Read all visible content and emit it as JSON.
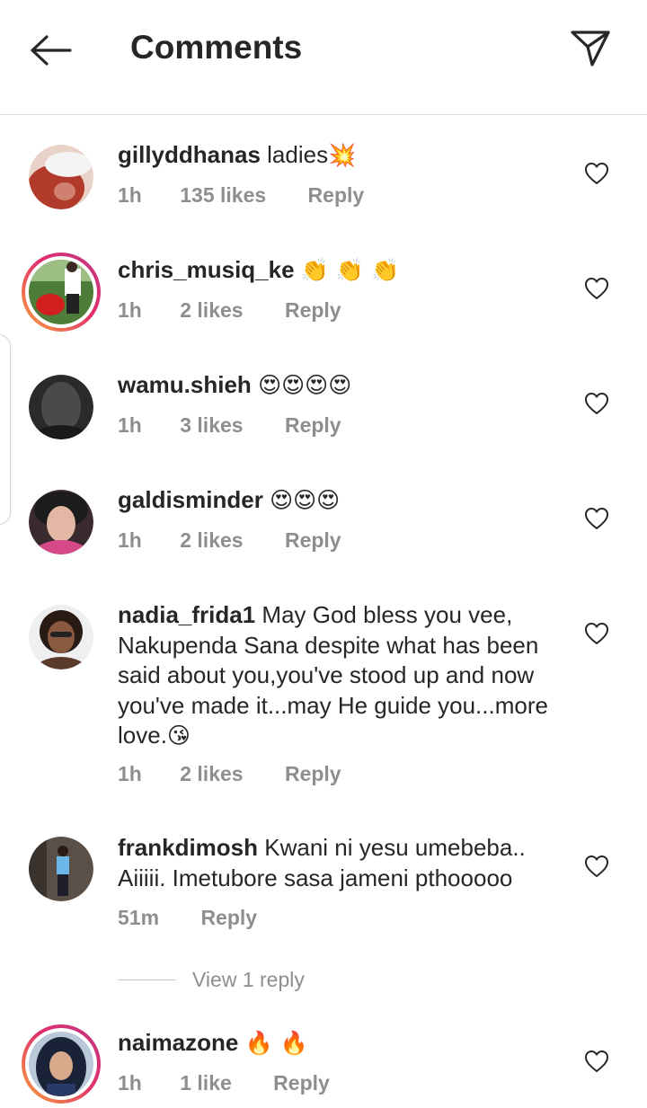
{
  "header": {
    "title": "Comments",
    "back_icon": "back-arrow-icon",
    "share_icon": "direct-send-icon"
  },
  "comments": [
    {
      "username": "gillyddhanas",
      "text": "ladies",
      "emoji": "💥",
      "time": "1h",
      "likes": "135 likes",
      "reply": "Reply",
      "story_ring": false
    },
    {
      "username": "chris_musiq_ke",
      "text": "",
      "emoji": "👏 👏 👏",
      "time": "1h",
      "likes": "2 likes",
      "reply": "Reply",
      "story_ring": true
    },
    {
      "username": "wamu.shieh",
      "text": "",
      "emoji": "😍😍😍😍",
      "time": "1h",
      "likes": "3 likes",
      "reply": "Reply",
      "story_ring": false
    },
    {
      "username": "galdisminder",
      "text": "",
      "emoji": "😍😍😍",
      "time": "1h",
      "likes": "2 likes",
      "reply": "Reply",
      "story_ring": false
    },
    {
      "username": "nadia_frida1",
      "text": "May God bless you vee, Nakupenda Sana despite what has been said about you,you've stood up and now you've made it...may He guide you...more love.",
      "emoji": "😘",
      "time": "1h",
      "likes": "2 likes",
      "reply": "Reply",
      "story_ring": false
    },
    {
      "username": "frankdimosh",
      "text": "Kwani ni yesu umebeba.. Aiiiii. Imetubore sasa jameni pthooooo",
      "emoji": "",
      "time": "51m",
      "likes": "",
      "reply": "Reply",
      "story_ring": false
    },
    {
      "username": "naimazone",
      "text": "",
      "emoji": "🔥 🔥",
      "time": "1h",
      "likes": "1 like",
      "reply": "Reply",
      "story_ring": true
    }
  ],
  "view_replies": {
    "label": "View 1 reply"
  },
  "colors": {
    "text": "#262626",
    "secondary": "#8e8e8e",
    "divider": "#dbdbdb",
    "story_ring_start": "#f9a53a",
    "story_ring_end": "#c13584"
  },
  "icons": {
    "like": "heart-outline-icon"
  }
}
